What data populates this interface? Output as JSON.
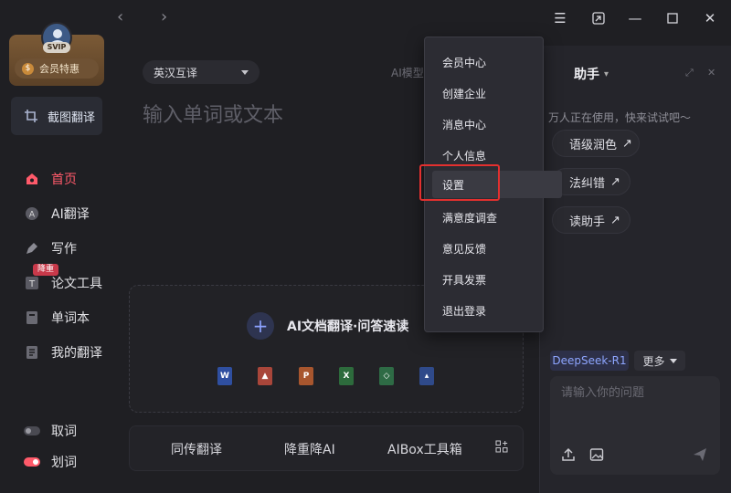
{
  "sidebar": {
    "vip_badge": "SVIP",
    "member_button": "会员特惠",
    "screenshot_translate": "截图翻译",
    "items": [
      {
        "label": "首页",
        "icon": "home-icon",
        "active": true
      },
      {
        "label": "AI翻译",
        "icon": "ai-icon",
        "active": false
      },
      {
        "label": "写作",
        "icon": "pen-icon",
        "active": false
      },
      {
        "label": "论文工具",
        "icon": "thesis-icon",
        "active": false,
        "badge": "降重"
      },
      {
        "label": "单词本",
        "icon": "wordbook-icon",
        "active": false
      },
      {
        "label": "我的翻译",
        "icon": "history-icon",
        "active": false
      }
    ],
    "toggles": [
      {
        "label": "取词",
        "on": false
      },
      {
        "label": "划词",
        "on": true
      }
    ]
  },
  "main": {
    "language_pair": "英汉互译",
    "ai_model_label": "AI模型",
    "input_placeholder": "输入单词或文本",
    "upload_label": "AI文档翻译·问答速读",
    "file_types": [
      "W",
      "PDF",
      "P",
      "X",
      "TXT",
      "IMG"
    ],
    "tools": [
      "同传翻译",
      "降重降AI",
      "AIBox工具箱"
    ]
  },
  "assistant": {
    "title": "助手",
    "tip": "万人正在使用，快来试试吧～",
    "suggestions": [
      "语级润色",
      "法纠错",
      "读助手"
    ],
    "model": "DeepSeek-R1",
    "more": "更多",
    "input_placeholder": "请输入你的问题"
  },
  "menu": {
    "items": [
      "会员中心",
      "创建企业",
      "消息中心",
      "个人信息",
      "设置",
      "满意度调查",
      "意见反馈",
      "开具发票",
      "退出登录"
    ],
    "highlighted": "设置"
  },
  "colors": {
    "accent": "#ff5a6a",
    "highlight_box": "#e3302f",
    "model_chip": "#8ea6ff"
  }
}
